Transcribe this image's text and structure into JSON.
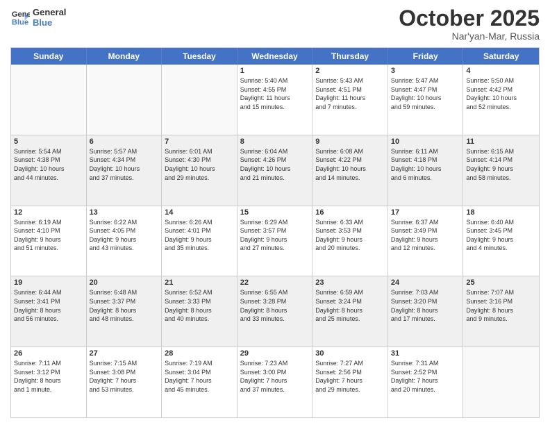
{
  "header": {
    "logo_line1": "General",
    "logo_line2": "Blue",
    "month_title": "October 2025",
    "location": "Nar'yan-Mar, Russia"
  },
  "weekdays": [
    "Sunday",
    "Monday",
    "Tuesday",
    "Wednesday",
    "Thursday",
    "Friday",
    "Saturday"
  ],
  "rows": [
    [
      {
        "day": "",
        "info": ""
      },
      {
        "day": "",
        "info": ""
      },
      {
        "day": "",
        "info": ""
      },
      {
        "day": "1",
        "info": "Sunrise: 5:40 AM\nSunset: 4:55 PM\nDaylight: 11 hours\nand 15 minutes."
      },
      {
        "day": "2",
        "info": "Sunrise: 5:43 AM\nSunset: 4:51 PM\nDaylight: 11 hours\nand 7 minutes."
      },
      {
        "day": "3",
        "info": "Sunrise: 5:47 AM\nSunset: 4:47 PM\nDaylight: 10 hours\nand 59 minutes."
      },
      {
        "day": "4",
        "info": "Sunrise: 5:50 AM\nSunset: 4:42 PM\nDaylight: 10 hours\nand 52 minutes."
      }
    ],
    [
      {
        "day": "5",
        "info": "Sunrise: 5:54 AM\nSunset: 4:38 PM\nDaylight: 10 hours\nand 44 minutes."
      },
      {
        "day": "6",
        "info": "Sunrise: 5:57 AM\nSunset: 4:34 PM\nDaylight: 10 hours\nand 37 minutes."
      },
      {
        "day": "7",
        "info": "Sunrise: 6:01 AM\nSunset: 4:30 PM\nDaylight: 10 hours\nand 29 minutes."
      },
      {
        "day": "8",
        "info": "Sunrise: 6:04 AM\nSunset: 4:26 PM\nDaylight: 10 hours\nand 21 minutes."
      },
      {
        "day": "9",
        "info": "Sunrise: 6:08 AM\nSunset: 4:22 PM\nDaylight: 10 hours\nand 14 minutes."
      },
      {
        "day": "10",
        "info": "Sunrise: 6:11 AM\nSunset: 4:18 PM\nDaylight: 10 hours\nand 6 minutes."
      },
      {
        "day": "11",
        "info": "Sunrise: 6:15 AM\nSunset: 4:14 PM\nDaylight: 9 hours\nand 58 minutes."
      }
    ],
    [
      {
        "day": "12",
        "info": "Sunrise: 6:19 AM\nSunset: 4:10 PM\nDaylight: 9 hours\nand 51 minutes."
      },
      {
        "day": "13",
        "info": "Sunrise: 6:22 AM\nSunset: 4:05 PM\nDaylight: 9 hours\nand 43 minutes."
      },
      {
        "day": "14",
        "info": "Sunrise: 6:26 AM\nSunset: 4:01 PM\nDaylight: 9 hours\nand 35 minutes."
      },
      {
        "day": "15",
        "info": "Sunrise: 6:29 AM\nSunset: 3:57 PM\nDaylight: 9 hours\nand 27 minutes."
      },
      {
        "day": "16",
        "info": "Sunrise: 6:33 AM\nSunset: 3:53 PM\nDaylight: 9 hours\nand 20 minutes."
      },
      {
        "day": "17",
        "info": "Sunrise: 6:37 AM\nSunset: 3:49 PM\nDaylight: 9 hours\nand 12 minutes."
      },
      {
        "day": "18",
        "info": "Sunrise: 6:40 AM\nSunset: 3:45 PM\nDaylight: 9 hours\nand 4 minutes."
      }
    ],
    [
      {
        "day": "19",
        "info": "Sunrise: 6:44 AM\nSunset: 3:41 PM\nDaylight: 8 hours\nand 56 minutes."
      },
      {
        "day": "20",
        "info": "Sunrise: 6:48 AM\nSunset: 3:37 PM\nDaylight: 8 hours\nand 48 minutes."
      },
      {
        "day": "21",
        "info": "Sunrise: 6:52 AM\nSunset: 3:33 PM\nDaylight: 8 hours\nand 40 minutes."
      },
      {
        "day": "22",
        "info": "Sunrise: 6:55 AM\nSunset: 3:28 PM\nDaylight: 8 hours\nand 33 minutes."
      },
      {
        "day": "23",
        "info": "Sunrise: 6:59 AM\nSunset: 3:24 PM\nDaylight: 8 hours\nand 25 minutes."
      },
      {
        "day": "24",
        "info": "Sunrise: 7:03 AM\nSunset: 3:20 PM\nDaylight: 8 hours\nand 17 minutes."
      },
      {
        "day": "25",
        "info": "Sunrise: 7:07 AM\nSunset: 3:16 PM\nDaylight: 8 hours\nand 9 minutes."
      }
    ],
    [
      {
        "day": "26",
        "info": "Sunrise: 7:11 AM\nSunset: 3:12 PM\nDaylight: 8 hours\nand 1 minute."
      },
      {
        "day": "27",
        "info": "Sunrise: 7:15 AM\nSunset: 3:08 PM\nDaylight: 7 hours\nand 53 minutes."
      },
      {
        "day": "28",
        "info": "Sunrise: 7:19 AM\nSunset: 3:04 PM\nDaylight: 7 hours\nand 45 minutes."
      },
      {
        "day": "29",
        "info": "Sunrise: 7:23 AM\nSunset: 3:00 PM\nDaylight: 7 hours\nand 37 minutes."
      },
      {
        "day": "30",
        "info": "Sunrise: 7:27 AM\nSunset: 2:56 PM\nDaylight: 7 hours\nand 29 minutes."
      },
      {
        "day": "31",
        "info": "Sunrise: 7:31 AM\nSunset: 2:52 PM\nDaylight: 7 hours\nand 20 minutes."
      },
      {
        "day": "",
        "info": ""
      }
    ]
  ]
}
